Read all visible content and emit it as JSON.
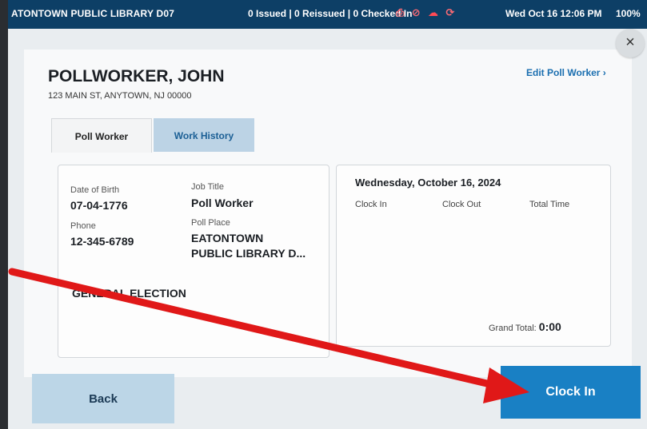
{
  "statusbar": {
    "location": "ATONTOWN PUBLIC LIBRARY D07",
    "counts": "0 Issued | 0 Reissued | 0 Checked In",
    "icons": [
      "printer-icon",
      "blocked-icon",
      "cloud-error-icon",
      "sync-icon"
    ],
    "datetime": "Wed Oct 16  12:06 PM",
    "battery": "100%"
  },
  "close_label": "×",
  "worker": {
    "name": "POLLWORKER, JOHN",
    "address": "123 MAIN ST, ANYTOWN, NJ 00000",
    "edit_link": "Edit Poll Worker ›"
  },
  "tabs": [
    {
      "label": "Poll Worker",
      "active": true
    },
    {
      "label": "Work History",
      "active": false
    }
  ],
  "details": {
    "dob_label": "Date of Birth",
    "dob_value": "07-04-1776",
    "phone_label": "Phone",
    "phone_value": "12-345-6789",
    "job_title_label": "Job Title",
    "job_title_value": "Poll Worker",
    "poll_place_label": "Poll Place",
    "poll_place_value_line1": "EATONTOWN",
    "poll_place_value_line2": "PUBLIC LIBRARY D...",
    "election_value": "GENERAL ELECTION"
  },
  "timesheet": {
    "date": "Wednesday, October 16, 2024",
    "columns": [
      "Clock In",
      "Clock Out",
      "Total Time"
    ],
    "grand_total_label": "Grand Total:",
    "grand_total_value": "0:00"
  },
  "buttons": {
    "back": "Back",
    "clock_in": "Clock In"
  },
  "colors": {
    "statusbar_bg": "#0d3f66",
    "primary_button": "#1980c4",
    "secondary_button": "#bcd6e7",
    "annotation_arrow": "#e01818"
  }
}
